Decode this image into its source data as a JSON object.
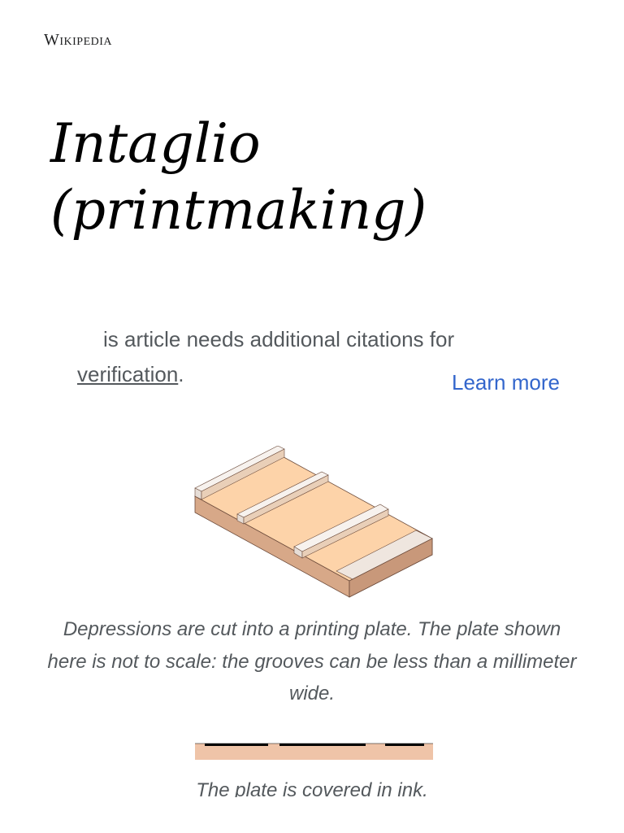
{
  "site": {
    "wordmark": "Wikipedia"
  },
  "article": {
    "title": "Intaglio (printmaking)"
  },
  "notice": {
    "text_line1": "is article needs additional citations for",
    "link": "verification",
    "trailing": ".",
    "learn_more": "Learn more"
  },
  "figures": [
    {
      "caption": "Depressions are cut into a printing plate. The plate shown here is not to scale: the grooves can be less than a millimeter wide."
    },
    {
      "caption": "The plate is covered in ink."
    }
  ],
  "colors": {
    "link": "#3366cc",
    "plate_top": "#fdd3a9",
    "plate_side": "#e2b590",
    "plate_front": "#c8987a",
    "ridge_top": "#f5efea",
    "ink": "#000000"
  }
}
